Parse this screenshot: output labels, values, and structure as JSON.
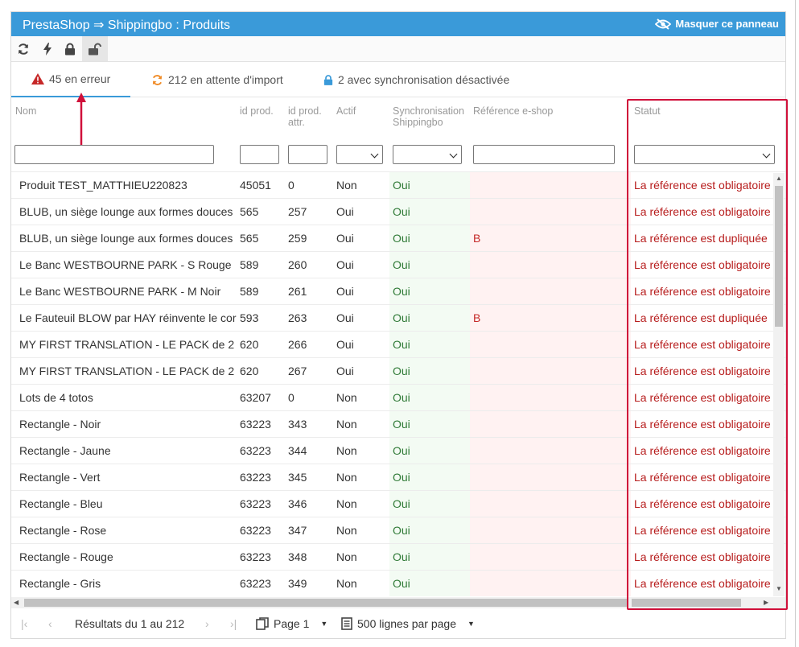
{
  "panel": {
    "title": "PrestaShop ⇒ Shippingbo : Produits",
    "hide_label": "Masquer ce panneau"
  },
  "toolbar": [
    "refresh-icon",
    "bolt-icon",
    "lock-icon",
    "unlock-icon"
  ],
  "tabs": [
    {
      "icon": "warning-icon",
      "label": "45 en erreur",
      "color": "#c62828"
    },
    {
      "icon": "sync-icon",
      "label": "212 en attente d'import",
      "color": "#f08a24"
    },
    {
      "icon": "lock-icon",
      "label": "2 avec synchronisation désactivée",
      "color": "#3a9ad9"
    }
  ],
  "columns": {
    "name": "Nom",
    "id_prod": "id prod.",
    "id_attr_1": "id prod.",
    "id_attr_2": "attr.",
    "active": "Actif",
    "sync_1": "Synchronisation",
    "sync_2": "Shippingbo",
    "ref": "Référence e-shop",
    "status": "Statut"
  },
  "rows": [
    {
      "name": "Produit TEST_MATTHIEU220823",
      "id": "45051",
      "attr": "0",
      "active": "Non",
      "sync": "Oui",
      "ref": "",
      "status": "La référence est obligatoire"
    },
    {
      "name": "BLUB, un siège lounge aux formes douces",
      "id": "565",
      "attr": "257",
      "active": "Oui",
      "sync": "Oui",
      "ref": "",
      "status": "La référence est obligatoire"
    },
    {
      "name": "BLUB, un siège lounge aux formes douces",
      "id": "565",
      "attr": "259",
      "active": "Oui",
      "sync": "Oui",
      "ref": "B",
      "status": "La référence est dupliquée"
    },
    {
      "name": "Le Banc WESTBOURNE PARK - S Rouge",
      "id": "589",
      "attr": "260",
      "active": "Oui",
      "sync": "Oui",
      "ref": "",
      "status": "La référence est obligatoire"
    },
    {
      "name": "Le Banc WESTBOURNE PARK - M Noir",
      "id": "589",
      "attr": "261",
      "active": "Oui",
      "sync": "Oui",
      "ref": "",
      "status": "La référence est obligatoire"
    },
    {
      "name": "Le Fauteuil BLOW par HAY réinvente le cor",
      "id": "593",
      "attr": "263",
      "active": "Oui",
      "sync": "Oui",
      "ref": "B",
      "status": "La référence est dupliquée"
    },
    {
      "name": "MY FIRST TRANSLATION - LE PACK de 2",
      "id": "620",
      "attr": "266",
      "active": "Oui",
      "sync": "Oui",
      "ref": "",
      "status": "La référence est obligatoire"
    },
    {
      "name": "MY FIRST TRANSLATION - LE PACK de 2",
      "id": "620",
      "attr": "267",
      "active": "Oui",
      "sync": "Oui",
      "ref": "",
      "status": "La référence est obligatoire"
    },
    {
      "name": "Lots de 4 totos",
      "id": "63207",
      "attr": "0",
      "active": "Non",
      "sync": "Oui",
      "ref": "",
      "status": "La référence est obligatoire"
    },
    {
      "name": "Rectangle - Noir",
      "id": "63223",
      "attr": "343",
      "active": "Non",
      "sync": "Oui",
      "ref": "",
      "status": "La référence est obligatoire"
    },
    {
      "name": "Rectangle - Jaune",
      "id": "63223",
      "attr": "344",
      "active": "Non",
      "sync": "Oui",
      "ref": "",
      "status": "La référence est obligatoire"
    },
    {
      "name": "Rectangle - Vert",
      "id": "63223",
      "attr": "345",
      "active": "Non",
      "sync": "Oui",
      "ref": "",
      "status": "La référence est obligatoire"
    },
    {
      "name": "Rectangle - Bleu",
      "id": "63223",
      "attr": "346",
      "active": "Non",
      "sync": "Oui",
      "ref": "",
      "status": "La référence est obligatoire"
    },
    {
      "name": "Rectangle - Rose",
      "id": "63223",
      "attr": "347",
      "active": "Non",
      "sync": "Oui",
      "ref": "",
      "status": "La référence est obligatoire"
    },
    {
      "name": "Rectangle - Rouge",
      "id": "63223",
      "attr": "348",
      "active": "Non",
      "sync": "Oui",
      "ref": "",
      "status": "La référence est obligatoire"
    },
    {
      "name": "Rectangle - Gris",
      "id": "63223",
      "attr": "349",
      "active": "Non",
      "sync": "Oui",
      "ref": "",
      "status": "La référence est obligatoire"
    }
  ],
  "pager": {
    "results": "Résultats du 1 au 212",
    "page": "Page 1",
    "per_page": "500 lignes par page"
  },
  "colors": {
    "accent": "#3a9ad9",
    "error": "#b71c1c",
    "highlight": "#d0103a",
    "ok": "#2f7a36"
  }
}
